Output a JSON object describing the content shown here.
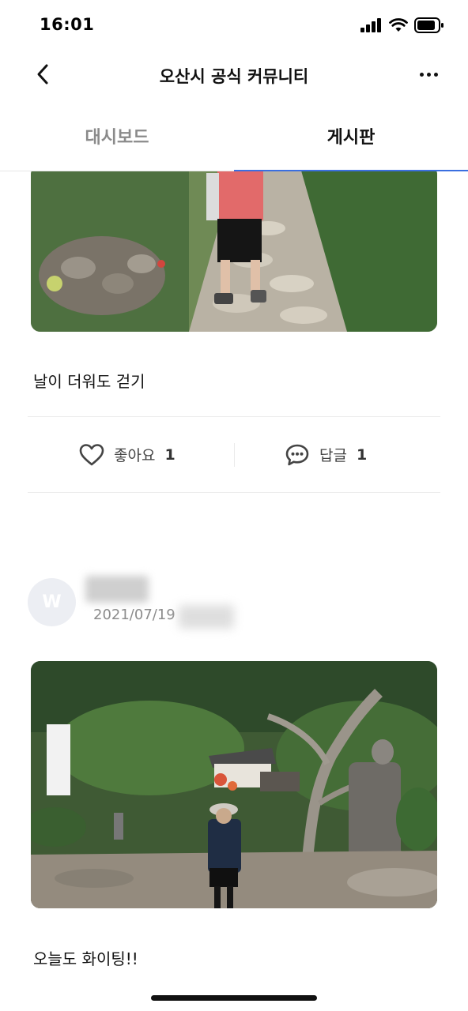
{
  "status_bar": {
    "time": "16:01",
    "icons": [
      "signal-icon",
      "wifi-icon",
      "battery-icon"
    ]
  },
  "nav": {
    "back_icon": "chevron-left-icon",
    "title": "오산시 공식 커뮤니티",
    "more_icon": "more-horizontal-icon"
  },
  "tabs": [
    {
      "label": "대시보드",
      "active": false
    },
    {
      "label": "게시판",
      "active": true
    }
  ],
  "colors": {
    "tab_indicator": "#3b6fe0",
    "inactive_tab": "#8a8a8a",
    "avatar_bg": "#eceef3"
  },
  "posts": [
    {
      "image_desc_icon": "photo-garden-path",
      "text": "날이 더워도 걷기",
      "like": {
        "label": "좋아요",
        "count": "1",
        "icon": "heart-icon"
      },
      "comment": {
        "label": "답글",
        "count": "1",
        "icon": "comment-icon"
      }
    },
    {
      "avatar_letter": "W",
      "date": "2021/07/19",
      "image_desc_icon": "photo-garden-statue",
      "text": "오늘도 화이팅!!"
    }
  ]
}
